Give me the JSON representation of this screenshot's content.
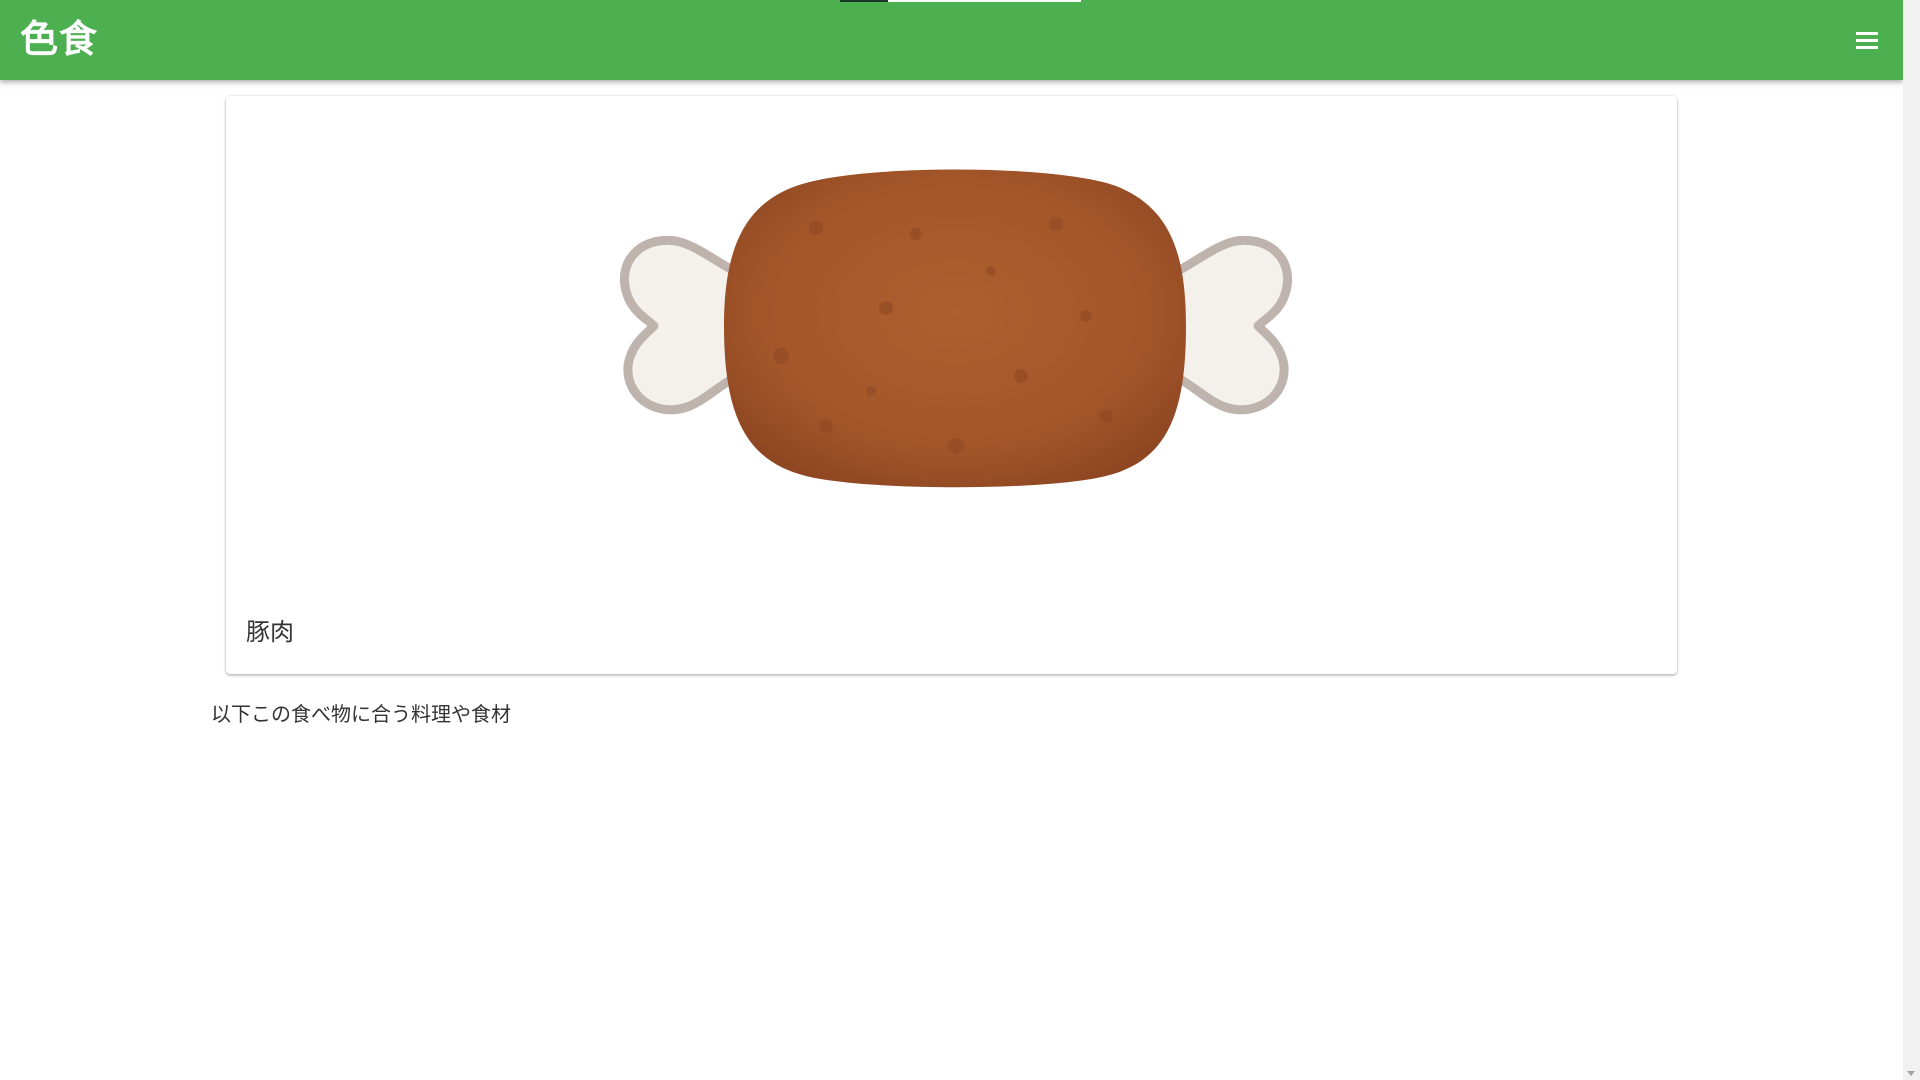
{
  "app_bar": {
    "title": "色食",
    "background_color": "#4caf50",
    "menu_icon": "hamburger-menu-icon"
  },
  "food": {
    "name": "豚肉",
    "image_subject": "meat-on-bone",
    "image_colors": {
      "meat": "#a4562a",
      "meat_dark": "#8e4722",
      "bone": "#f4f1ec",
      "bone_outline": "#bfb4ad"
    }
  },
  "section": {
    "caption": "以下この食べ物に合う料理や食材"
  }
}
